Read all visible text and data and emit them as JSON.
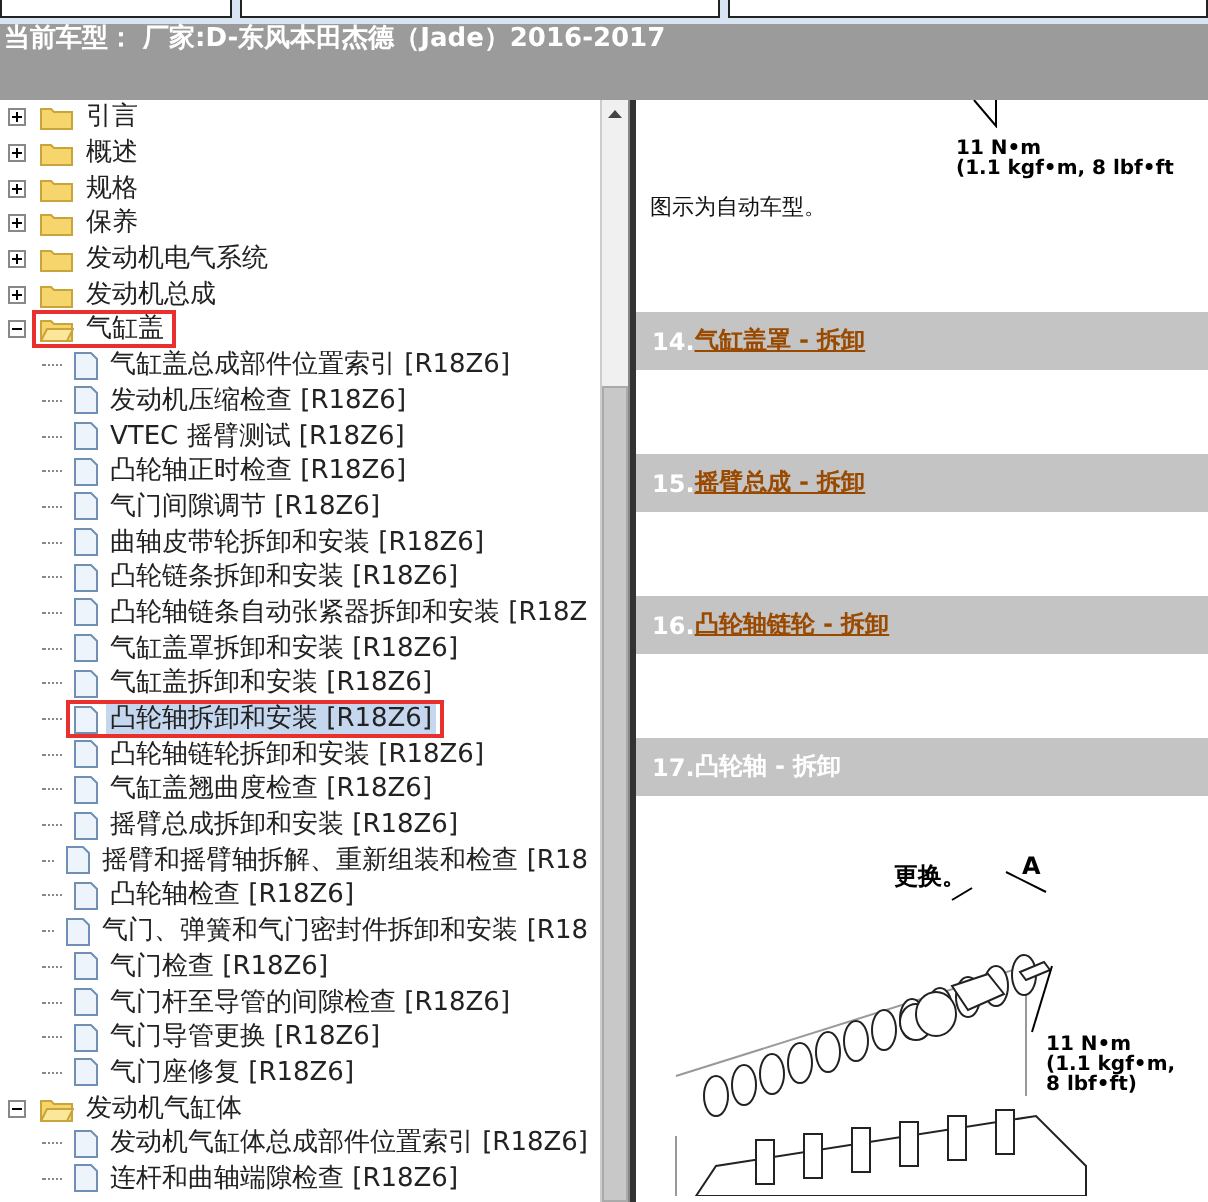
{
  "header": {
    "title": "当前车型： 厂家:D-东风本田杰德（Jade）2016-2017"
  },
  "tree": [
    {
      "label": "引言",
      "kind": "folder",
      "expanded": false,
      "selected": false,
      "marked": false
    },
    {
      "label": "概述",
      "kind": "folder",
      "expanded": false,
      "selected": false,
      "marked": false
    },
    {
      "label": "规格",
      "kind": "folder",
      "expanded": false,
      "selected": false,
      "marked": false
    },
    {
      "label": "保养",
      "kind": "folder",
      "expanded": false,
      "selected": false,
      "marked": false
    },
    {
      "label": "发动机电气系统",
      "kind": "folder",
      "expanded": false,
      "selected": false,
      "marked": false
    },
    {
      "label": "发动机总成",
      "kind": "folder",
      "expanded": false,
      "selected": false,
      "marked": false
    },
    {
      "label": "气缸盖",
      "kind": "folder",
      "expanded": true,
      "selected": false,
      "marked": true,
      "children": [
        {
          "label": "气缸盖总成部件位置索引 [R18Z6]",
          "kind": "page",
          "selected": false,
          "marked": false
        },
        {
          "label": "发动机压缩检查 [R18Z6]",
          "kind": "page",
          "selected": false,
          "marked": false
        },
        {
          "label": "VTEC 摇臂测试 [R18Z6]",
          "kind": "page",
          "selected": false,
          "marked": false
        },
        {
          "label": "凸轮轴正时检查 [R18Z6]",
          "kind": "page",
          "selected": false,
          "marked": false
        },
        {
          "label": "气门间隙调节 [R18Z6]",
          "kind": "page",
          "selected": false,
          "marked": false
        },
        {
          "label": "曲轴皮带轮拆卸和安装 [R18Z6]",
          "kind": "page",
          "selected": false,
          "marked": false
        },
        {
          "label": "凸轮链条拆卸和安装 [R18Z6]",
          "kind": "page",
          "selected": false,
          "marked": false
        },
        {
          "label": "凸轮轴链条自动张紧器拆卸和安装 [R18Z",
          "kind": "page",
          "selected": false,
          "marked": false
        },
        {
          "label": "气缸盖罩拆卸和安装 [R18Z6]",
          "kind": "page",
          "selected": false,
          "marked": false
        },
        {
          "label": "气缸盖拆卸和安装 [R18Z6]",
          "kind": "page",
          "selected": false,
          "marked": false
        },
        {
          "label": "凸轮轴拆卸和安装 [R18Z6]",
          "kind": "page",
          "selected": true,
          "marked": true
        },
        {
          "label": "凸轮轴链轮拆卸和安装 [R18Z6]",
          "kind": "page",
          "selected": false,
          "marked": false
        },
        {
          "label": "气缸盖翘曲度检查 [R18Z6]",
          "kind": "page",
          "selected": false,
          "marked": false
        },
        {
          "label": "摇臂总成拆卸和安装 [R18Z6]",
          "kind": "page",
          "selected": false,
          "marked": false
        },
        {
          "label": "摇臂和摇臂轴拆解、重新组装和检查 [R18",
          "kind": "page",
          "selected": false,
          "marked": false
        },
        {
          "label": "凸轮轴检查 [R18Z6]",
          "kind": "page",
          "selected": false,
          "marked": false
        },
        {
          "label": "气门、弹簧和气门密封件拆卸和安装 [R18",
          "kind": "page",
          "selected": false,
          "marked": false
        },
        {
          "label": "气门检查 [R18Z6]",
          "kind": "page",
          "selected": false,
          "marked": false
        },
        {
          "label": "气门杆至导管的间隙检查 [R18Z6]",
          "kind": "page",
          "selected": false,
          "marked": false
        },
        {
          "label": "气门导管更换 [R18Z6]",
          "kind": "page",
          "selected": false,
          "marked": false
        },
        {
          "label": "气门座修复 [R18Z6]",
          "kind": "page",
          "selected": false,
          "marked": false
        }
      ]
    },
    {
      "label": "发动机气缸体",
      "kind": "folder",
      "expanded": true,
      "selected": false,
      "marked": false,
      "children": [
        {
          "label": "发动机气缸体总成部件位置索引 [R18Z6]",
          "kind": "page",
          "selected": false,
          "marked": false
        },
        {
          "label": "连杆和曲轴端隙检查 [R18Z6]",
          "kind": "page",
          "selected": false,
          "marked": false
        }
      ]
    }
  ],
  "document": {
    "top_torque": [
      "11 N•m",
      "(1.1 kgf•m, 8 lbf•ft"
    ],
    "note": "图示为自动车型。",
    "sections": [
      {
        "number": "14.",
        "title": "气缸盖罩 - 拆卸",
        "kind": "link"
      },
      {
        "number": "15.",
        "title": "摇臂总成 - 拆卸",
        "kind": "link"
      },
      {
        "number": "16.",
        "title": "凸轮轴链轮 - 拆卸",
        "kind": "link"
      },
      {
        "number": "17.",
        "title": "凸轮轴 - 拆卸",
        "kind": "plain"
      }
    ],
    "figure": {
      "replace_label": "更换。",
      "part_label": "A",
      "torque": [
        "11 N•m",
        "(1.1 kgf•m,",
        "8 lbf•ft)"
      ]
    }
  }
}
